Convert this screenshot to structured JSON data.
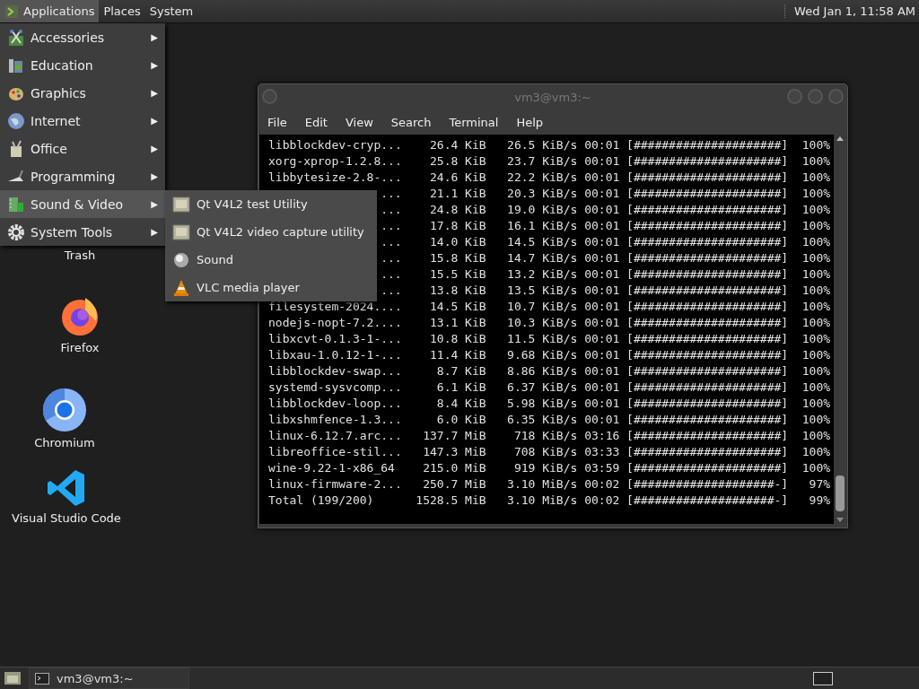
{
  "top_panel": {
    "menus": [
      {
        "label": "Applications",
        "selected": true
      },
      {
        "label": "Places",
        "selected": false
      },
      {
        "label": "System",
        "selected": false
      }
    ],
    "clock": "Wed Jan 1, 11:58 AM"
  },
  "applications_menu": {
    "items": [
      {
        "label": "Accessories",
        "kind": "accessories",
        "selected": false
      },
      {
        "label": "Education",
        "kind": "education",
        "selected": false
      },
      {
        "label": "Graphics",
        "kind": "graphics",
        "selected": false
      },
      {
        "label": "Internet",
        "kind": "internet",
        "selected": false
      },
      {
        "label": "Office",
        "kind": "office",
        "selected": false
      },
      {
        "label": "Programming",
        "kind": "programming",
        "selected": false
      },
      {
        "label": "Sound & Video",
        "kind": "media",
        "selected": true
      },
      {
        "label": "System Tools",
        "kind": "gear",
        "selected": false
      }
    ],
    "arrow": "▶",
    "submenu": [
      {
        "label": "Qt V4L2 test Utility",
        "kind": "app"
      },
      {
        "label": "Qt V4L2 video capture utility",
        "kind": "app"
      },
      {
        "label": "Sound",
        "kind": "sound"
      },
      {
        "label": "VLC media player",
        "kind": "cone"
      }
    ]
  },
  "desktop_icons": [
    {
      "label": "Trash",
      "kind": "none"
    },
    {
      "label": "Firefox",
      "kind": "firefox"
    },
    {
      "label": "Chromium",
      "kind": "chromium"
    },
    {
      "label": "Visual Studio Code",
      "kind": "vscode"
    }
  ],
  "terminal": {
    "title": "vm3@vm3:~",
    "menu": [
      "File",
      "Edit",
      "View",
      "Search",
      "Terminal",
      "Help"
    ],
    "rows": [
      {
        "kind": "full",
        "name": "libblockdev-cryp...",
        "size": "26.4 KiB",
        "rate": "26.5 KiB/s",
        "time": "00:01",
        "bar": "[#####################]",
        "percent": "100%"
      },
      {
        "kind": "full",
        "name": "xorg-xprop-1.2.8...",
        "size": "25.8 KiB",
        "rate": "23.7 KiB/s",
        "time": "00:01",
        "bar": "[#####################]",
        "percent": "100%"
      },
      {
        "kind": "full",
        "name": "libbytesize-2.8-...",
        "size": "24.6 KiB",
        "rate": "22.2 KiB/s",
        "time": "00:01",
        "bar": "[#####################]",
        "percent": "100%"
      },
      {
        "kind": "partial",
        "name": "...",
        "size": "21.1 KiB",
        "rate": "20.3 KiB/s",
        "time": "00:01",
        "bar": "[#####################]",
        "percent": "100%"
      },
      {
        "kind": "partial",
        "name": "...",
        "size": "24.8 KiB",
        "rate": "19.0 KiB/s",
        "time": "00:01",
        "bar": "[#####################]",
        "percent": "100%"
      },
      {
        "kind": "partial",
        "name": "...",
        "size": "17.8 KiB",
        "rate": "16.1 KiB/s",
        "time": "00:01",
        "bar": "[#####################]",
        "percent": "100%"
      },
      {
        "kind": "partial",
        "name": "...",
        "size": "14.0 KiB",
        "rate": "14.5 KiB/s",
        "time": "00:01",
        "bar": "[#####################]",
        "percent": "100%"
      },
      {
        "kind": "partial",
        "name": "...",
        "size": "15.8 KiB",
        "rate": "14.7 KiB/s",
        "time": "00:01",
        "bar": "[#####################]",
        "percent": "100%"
      },
      {
        "kind": "partial",
        "name": "...",
        "size": "15.5 KiB",
        "rate": "13.2 KiB/s",
        "time": "00:01",
        "bar": "[#####################]",
        "percent": "100%"
      },
      {
        "kind": "partial",
        "name": "...",
        "size": "13.8 KiB",
        "rate": "13.5 KiB/s",
        "time": "00:01",
        "bar": "[#####################]",
        "percent": "100%"
      },
      {
        "kind": "full",
        "name": "filesystem-2024....",
        "size": "14.5 KiB",
        "rate": "10.7 KiB/s",
        "time": "00:01",
        "bar": "[#####################]",
        "percent": "100%"
      },
      {
        "kind": "full",
        "name": "nodejs-nopt-7.2....",
        "size": "13.1 KiB",
        "rate": "10.3 KiB/s",
        "time": "00:01",
        "bar": "[#####################]",
        "percent": "100%"
      },
      {
        "kind": "full",
        "name": "libxcvt-0.1.3-1-...",
        "size": "10.8 KiB",
        "rate": "11.5 KiB/s",
        "time": "00:01",
        "bar": "[#####################]",
        "percent": "100%"
      },
      {
        "kind": "full",
        "name": "libxau-1.0.12-1-...",
        "size": "11.4 KiB",
        "rate": "9.68 KiB/s",
        "time": "00:01",
        "bar": "[#####################]",
        "percent": "100%"
      },
      {
        "kind": "full",
        "name": "libblockdev-swap...",
        "size": "8.7 KiB",
        "rate": "8.86 KiB/s",
        "time": "00:01",
        "bar": "[#####################]",
        "percent": "100%"
      },
      {
        "kind": "full",
        "name": "systemd-sysvcomp...",
        "size": "6.1 KiB",
        "rate": "6.37 KiB/s",
        "time": "00:01",
        "bar": "[#####################]",
        "percent": "100%"
      },
      {
        "kind": "full",
        "name": "libblockdev-loop...",
        "size": "8.4 KiB",
        "rate": "5.98 KiB/s",
        "time": "00:01",
        "bar": "[#####################]",
        "percent": "100%"
      },
      {
        "kind": "full",
        "name": "libxshmfence-1.3...",
        "size": "6.0 KiB",
        "rate": "6.35 KiB/s",
        "time": "00:01",
        "bar": "[#####################]",
        "percent": "100%"
      },
      {
        "kind": "full",
        "name": "linux-6.12.7.arc...",
        "size": "137.7 MiB",
        "rate": "718 KiB/s",
        "time": "03:16",
        "bar": "[#####################]",
        "percent": "100%"
      },
      {
        "kind": "full",
        "name": "libreoffice-stil...",
        "size": "147.3 MiB",
        "rate": "708 KiB/s",
        "time": "03:33",
        "bar": "[#####################]",
        "percent": "100%"
      },
      {
        "kind": "full",
        "name": "wine-9.22-1-x86_64",
        "size": "215.0 MiB",
        "rate": "919 KiB/s",
        "time": "03:59",
        "bar": "[#####################]",
        "percent": "100%"
      },
      {
        "kind": "full",
        "name": "linux-firmware-2...",
        "size": "250.7 MiB",
        "rate": "3.10 MiB/s",
        "time": "00:02",
        "bar": "[####################-]",
        "percent": "97%"
      },
      {
        "kind": "full",
        "name": "Total (199/200)",
        "size": "1528.5 MiB",
        "rate": "3.10 MiB/s",
        "time": "00:02",
        "bar": "[####################-]",
        "percent": "99%"
      }
    ]
  },
  "taskbar": {
    "tasks": [
      {
        "label": "vm3@vm3:~"
      }
    ]
  }
}
